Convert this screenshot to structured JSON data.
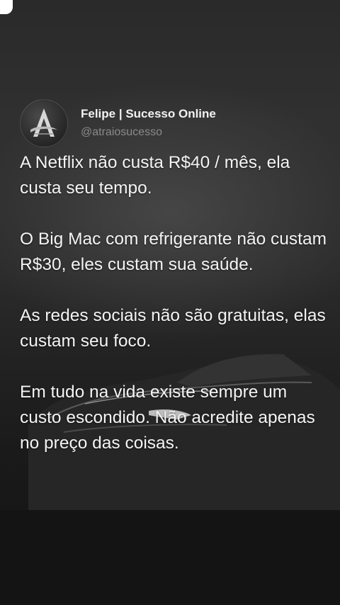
{
  "author": {
    "name": "Felipe | Sucesso Online",
    "handle": "@atraiosucesso",
    "avatar_icon": "letter-a-logo"
  },
  "post": {
    "paragraphs": [
      "A Netflix não custa R$40 / mês, ela custa seu tempo.",
      "O Big Mac com refrigerante não custam R$30, eles custam sua saúde.",
      "As redes sociais não são gratuitas, elas custam seu foco.",
      "Em tudo na vida existe sempre um custo escondido. Não acredite apenas no preço das coisas."
    ]
  },
  "colors": {
    "text": "#f4f4f4",
    "handle": "#8b8b8b",
    "background": "#1b1b1b"
  }
}
